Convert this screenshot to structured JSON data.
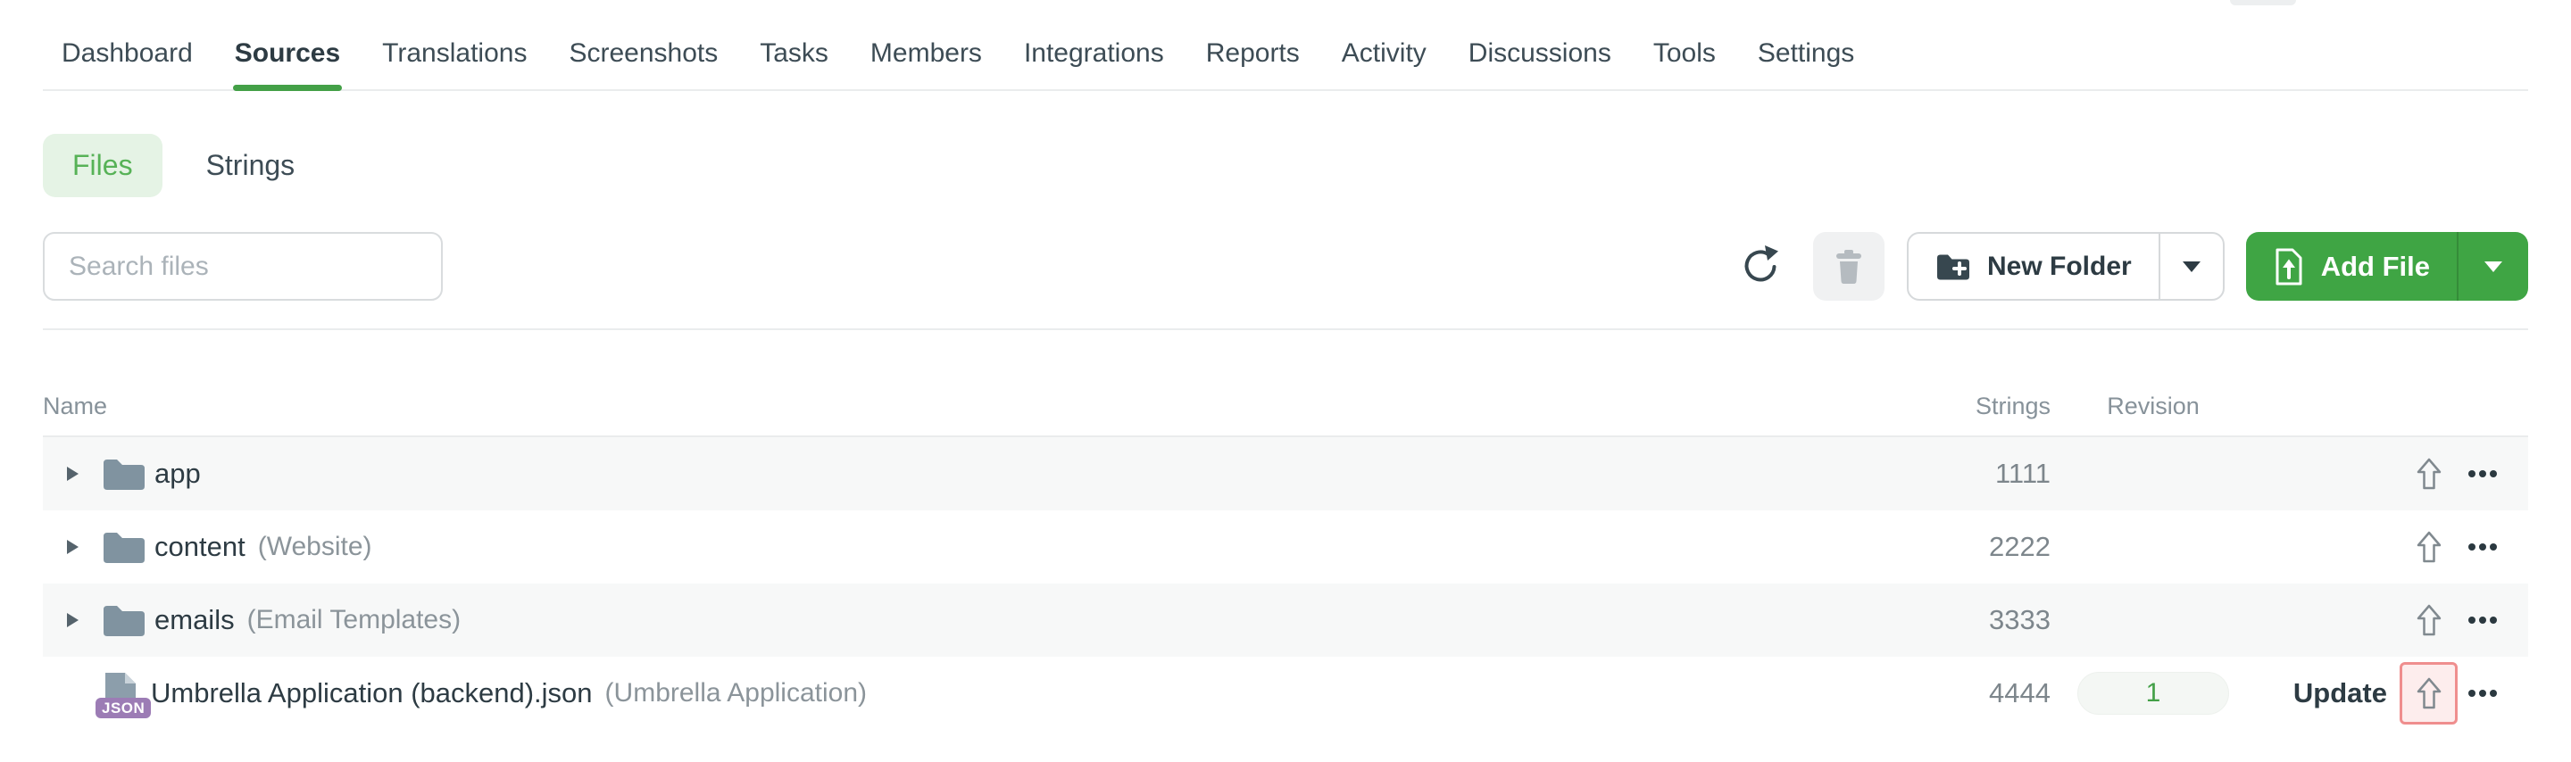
{
  "nav": {
    "items": [
      {
        "label": "Dashboard",
        "active": false
      },
      {
        "label": "Sources",
        "active": true
      },
      {
        "label": "Translations",
        "active": false
      },
      {
        "label": "Screenshots",
        "active": false
      },
      {
        "label": "Tasks",
        "active": false
      },
      {
        "label": "Members",
        "active": false
      },
      {
        "label": "Integrations",
        "active": false
      },
      {
        "label": "Reports",
        "active": false
      },
      {
        "label": "Activity",
        "active": false
      },
      {
        "label": "Discussions",
        "active": false
      },
      {
        "label": "Tools",
        "active": false
      },
      {
        "label": "Settings",
        "active": false
      }
    ]
  },
  "view_toggle": {
    "files_label": "Files",
    "strings_label": "Strings",
    "selected": "Files"
  },
  "toolbar": {
    "search_placeholder": "Search files",
    "search_value": "",
    "new_folder_label": "New Folder",
    "add_file_label": "Add File"
  },
  "table": {
    "headers": {
      "name": "Name",
      "strings": "Strings",
      "revision": "Revision"
    },
    "rows": [
      {
        "type": "folder",
        "name": "app",
        "note": "",
        "strings": "1111",
        "revision": ""
      },
      {
        "type": "folder",
        "name": "content",
        "note": "(Website)",
        "strings": "2222",
        "revision": ""
      },
      {
        "type": "folder",
        "name": "emails",
        "note": "(Email Templates)",
        "strings": "3333",
        "revision": ""
      },
      {
        "type": "file",
        "badge": "JSON",
        "name": "Umbrella Application (backend).json",
        "note": "(Umbrella Application)",
        "strings": "4444",
        "revision": "1",
        "update_label": "Update",
        "upload_highlighted": true
      }
    ]
  },
  "colors": {
    "accent_green": "#43a047",
    "add_file_bg": "#3fa544",
    "files_pill_bg": "#e5f3e5",
    "files_pill_text": "#57b257",
    "row_alt_bg": "#f7f8f8",
    "json_badge_purple": "#9c7cb5",
    "upload_highlight_border": "#ef8e8e",
    "upload_highlight_bg": "#fdeded",
    "revision_badge_text": "#43a047"
  }
}
